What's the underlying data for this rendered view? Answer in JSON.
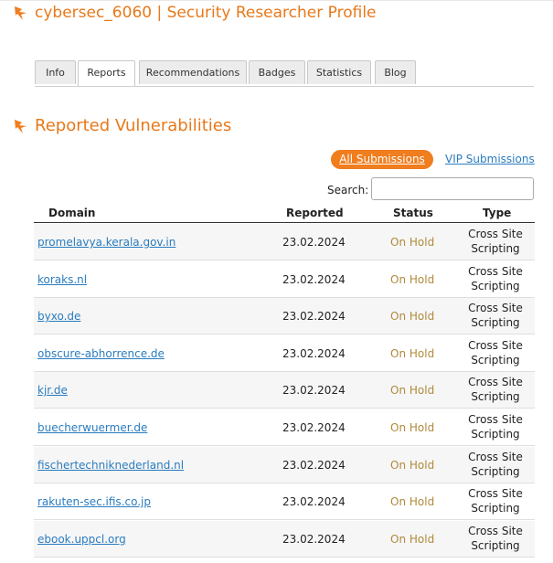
{
  "header": {
    "title": "cybersec_6060 | Security Researcher Profile"
  },
  "tabs": [
    {
      "label": "Info"
    },
    {
      "label": "Reports"
    },
    {
      "label": "Recommendations"
    },
    {
      "label": "Badges"
    },
    {
      "label": "Statistics"
    },
    {
      "label": "Blog"
    }
  ],
  "section": {
    "title": "Reported Vulnerabilities"
  },
  "filters": {
    "all": "All Submissions",
    "vip": "VIP Submissions"
  },
  "search": {
    "label": "Search:"
  },
  "table": {
    "columns": [
      "Domain",
      "Reported",
      "Status",
      "Type"
    ],
    "rows": [
      {
        "domain": "promelavya.kerala.gov.in",
        "date": "23.02.2024",
        "status": "On Hold",
        "type": "Cross Site Scripting"
      },
      {
        "domain": "koraks.nl",
        "date": "23.02.2024",
        "status": "On Hold",
        "type": "Cross Site Scripting"
      },
      {
        "domain": "byxo.de",
        "date": "23.02.2024",
        "status": "On Hold",
        "type": "Cross Site Scripting"
      },
      {
        "domain": "obscure-abhorrence.de",
        "date": "23.02.2024",
        "status": "On Hold",
        "type": "Cross Site Scripting"
      },
      {
        "domain": "kjr.de",
        "date": "23.02.2024",
        "status": "On Hold",
        "type": "Cross Site Scripting"
      },
      {
        "domain": "buecherwuermer.de",
        "date": "23.02.2024",
        "status": "On Hold",
        "type": "Cross Site Scripting"
      },
      {
        "domain": "fischertechniknederland.nl",
        "date": "23.02.2024",
        "status": "On Hold",
        "type": "Cross Site Scripting"
      },
      {
        "domain": "rakuten-sec.ifis.co.jp",
        "date": "23.02.2024",
        "status": "On Hold",
        "type": "Cross Site Scripting"
      },
      {
        "domain": "ebook.uppcl.org",
        "date": "23.02.2024",
        "status": "On Hold",
        "type": "Cross Site Scripting"
      }
    ]
  },
  "colors": {
    "accent": "#f07d1e",
    "link": "#2a7cbf",
    "status": "#b08a3a"
  }
}
